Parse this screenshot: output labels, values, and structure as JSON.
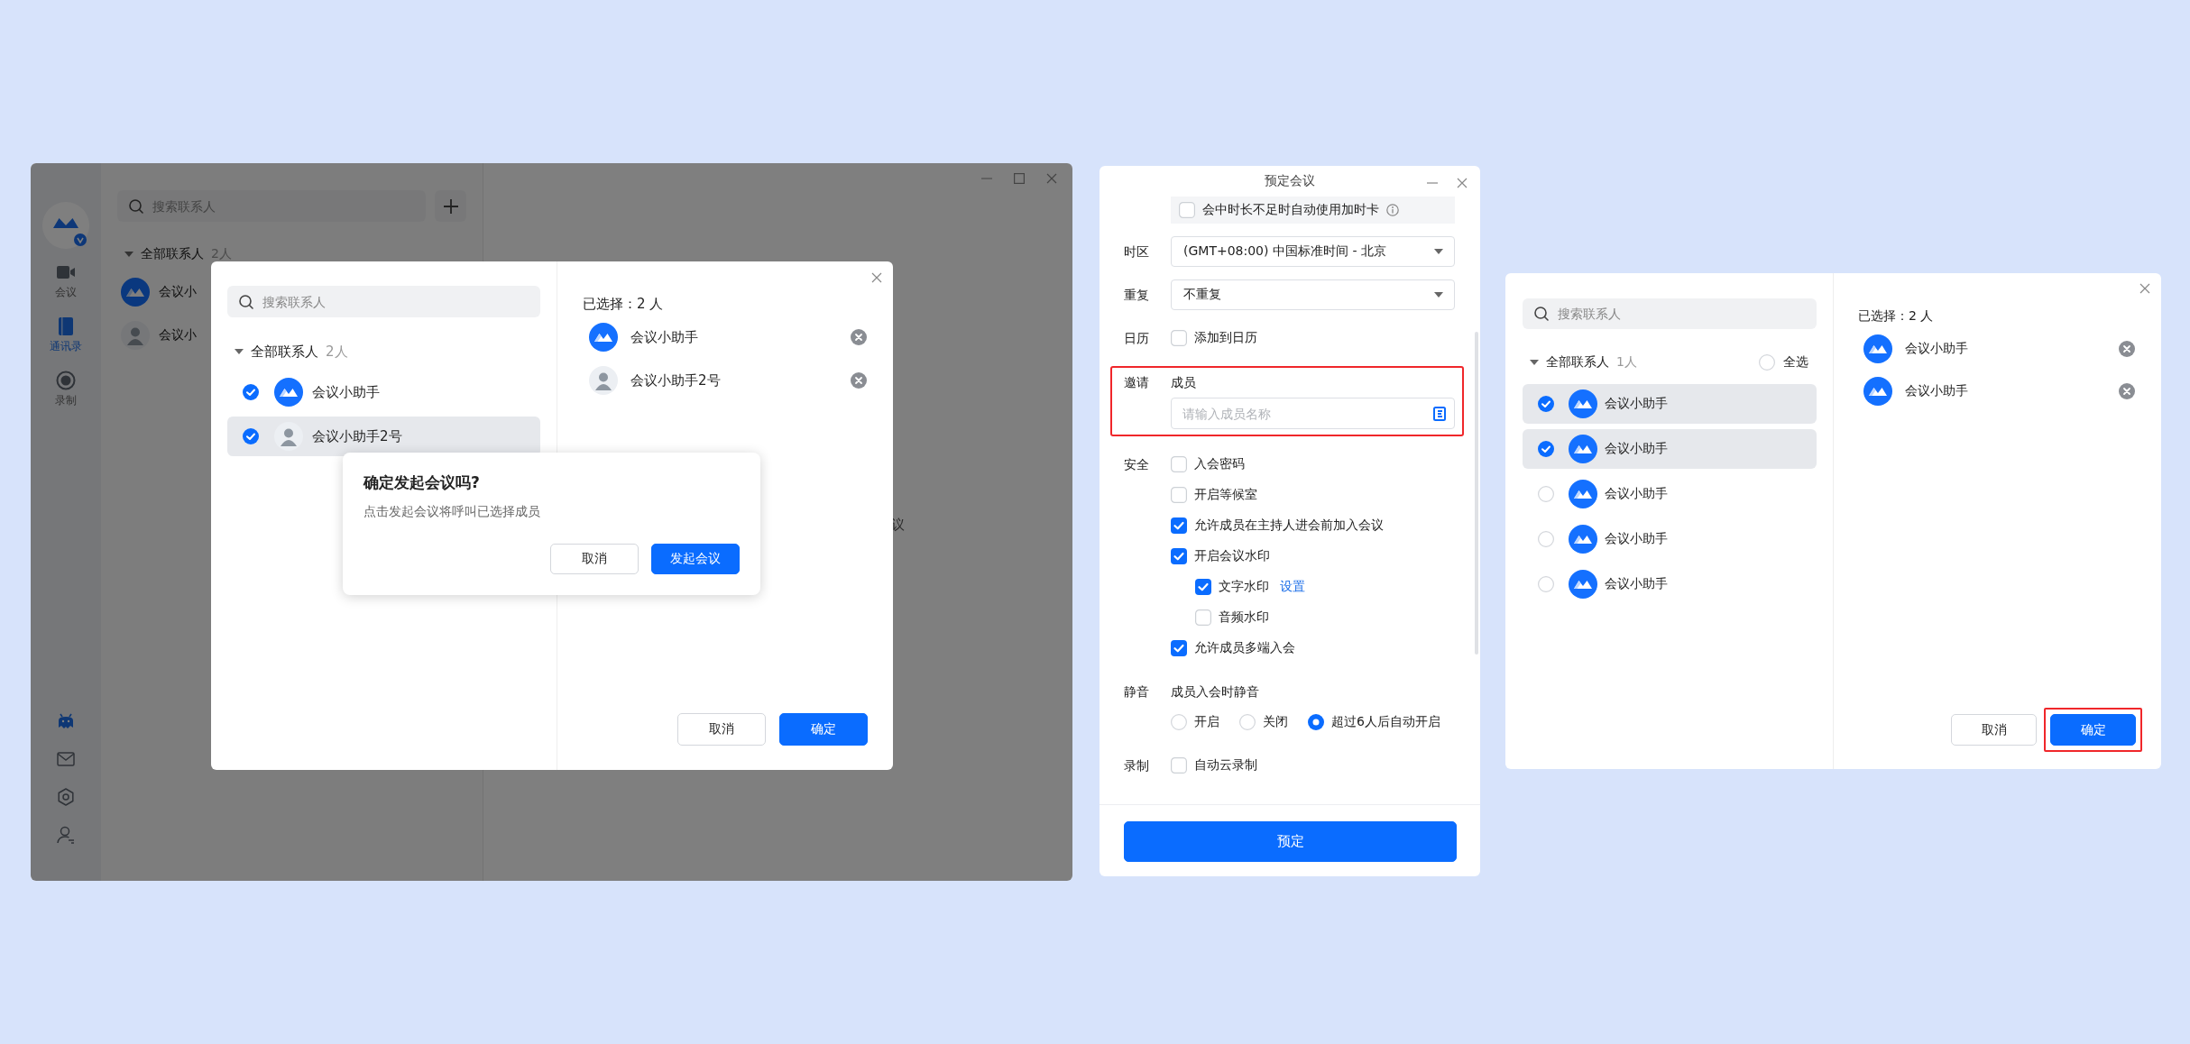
{
  "main_window": {
    "nav": [
      {
        "label": "会议",
        "selected": false
      },
      {
        "label": "通讯录",
        "selected": true
      },
      {
        "label": "录制",
        "selected": false
      }
    ],
    "search": {
      "placeholder": "搜索联系人"
    },
    "group": {
      "label": "全部联系人",
      "count": "2人"
    },
    "contacts": [
      {
        "name": "会议小",
        "kind": "logo"
      },
      {
        "name": "会议小",
        "kind": "person"
      }
    ],
    "main_text": "议",
    "picker": {
      "search": {
        "placeholder": "搜索联系人"
      },
      "group": {
        "label": "全部联系人",
        "count": "2人"
      },
      "contacts": [
        {
          "name": "会议小助手",
          "kind": "logo",
          "checked": true,
          "selected": false
        },
        {
          "name": "会议小助手2号",
          "kind": "person",
          "checked": true,
          "selected": true
        }
      ],
      "chosen_title": "已选择：2 人",
      "chosen": [
        {
          "name": "会议小助手",
          "kind": "logo"
        },
        {
          "name": "会议小助手2号",
          "kind": "person"
        }
      ],
      "buttons": [
        {
          "label": "取消",
          "kind": "secondary"
        },
        {
          "label": "确定",
          "kind": "primary"
        }
      ]
    },
    "confirm": {
      "title": "确定发起会议吗?",
      "message": "点击发起会议将呼叫已选择成员",
      "buttons": [
        {
          "label": "取消",
          "kind": "secondary"
        },
        {
          "label": "发起会议",
          "kind": "primary"
        }
      ]
    }
  },
  "schedule": {
    "title": "预定会议",
    "top_option": {
      "label": "会中时长不足时自动使用加时卡",
      "checked": false
    },
    "rows": [
      {
        "kind": "select",
        "label": "时区",
        "value": "(GMT+08:00) 中国标准时间 - 北京"
      },
      {
        "kind": "select",
        "label": "重复",
        "value": "不重复"
      },
      {
        "kind": "checks",
        "label": "日历",
        "options": [
          {
            "label": "添加到日历",
            "checked": false
          }
        ]
      },
      {
        "kind": "input",
        "label": "邀请",
        "caption": "成员",
        "placeholder": "请输入成员名称",
        "highlighted": true
      },
      {
        "kind": "checks",
        "label": "安全",
        "options": [
          {
            "label": "入会密码",
            "checked": false
          },
          {
            "label": "开启等候室",
            "checked": false
          },
          {
            "label": "允许成员在主持人进会前加入会议",
            "checked": true
          },
          {
            "label": "开启会议水印",
            "checked": true,
            "children": [
              {
                "label": "文字水印",
                "checked": true,
                "link": "设置"
              },
              {
                "label": "音频水印",
                "checked": false
              }
            ]
          },
          {
            "label": "允许成员多端入会",
            "checked": true
          }
        ]
      },
      {
        "kind": "radio",
        "label": "静音",
        "caption": "成员入会时静音",
        "options": [
          {
            "label": "开启",
            "selected": false
          },
          {
            "label": "关闭",
            "selected": false
          },
          {
            "label": "超过6人后自动开启",
            "selected": true
          }
        ]
      },
      {
        "kind": "checks",
        "label": "录制",
        "options": [
          {
            "label": "自动云录制",
            "checked": false
          }
        ]
      }
    ],
    "submit": "预定"
  },
  "picker2": {
    "search": {
      "placeholder": "搜索联系人"
    },
    "group": {
      "label": "全部联系人",
      "count": "1人"
    },
    "select_all": {
      "label": "全选",
      "checked": false
    },
    "contacts": [
      {
        "name": "会议小助手",
        "kind": "logo",
        "checked": true,
        "selected": true
      },
      {
        "name": "会议小助手",
        "kind": "logo",
        "checked": true,
        "selected": true
      },
      {
        "name": "会议小助手",
        "kind": "logo",
        "checked": false,
        "selected": false
      },
      {
        "name": "会议小助手",
        "kind": "logo",
        "checked": false,
        "selected": false
      },
      {
        "name": "会议小助手",
        "kind": "logo",
        "checked": false,
        "selected": false
      }
    ],
    "chosen_title": "已选择：2 人",
    "chosen": [
      {
        "name": "会议小助手",
        "kind": "logo"
      },
      {
        "name": "会议小助手",
        "kind": "logo"
      }
    ],
    "buttons": [
      {
        "label": "取消",
        "kind": "secondary",
        "highlighted": false
      },
      {
        "label": "确定",
        "kind": "primary",
        "highlighted": true
      }
    ]
  }
}
